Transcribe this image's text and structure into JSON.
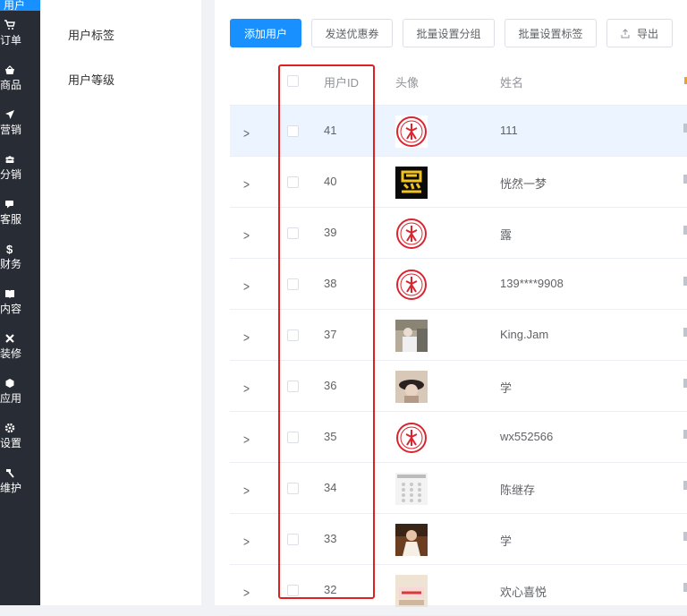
{
  "nav": {
    "active_label": "用户",
    "items": [
      {
        "label": "订单",
        "icon": "cart-icon"
      },
      {
        "label": "商品",
        "icon": "basket-icon"
      },
      {
        "label": "营销",
        "icon": "send-icon"
      },
      {
        "label": "分销",
        "icon": "group-icon"
      },
      {
        "label": "客服",
        "icon": "chat-icon"
      },
      {
        "label": "财务",
        "icon": "dollar-icon"
      },
      {
        "label": "内容",
        "icon": "book-icon"
      },
      {
        "label": "装修",
        "icon": "tools-icon"
      },
      {
        "label": "应用",
        "icon": "cube-icon"
      },
      {
        "label": "设置",
        "icon": "gear-icon"
      },
      {
        "label": "维护",
        "icon": "hammer-icon"
      }
    ]
  },
  "submenu": {
    "items": [
      "用户标签",
      "用户等级"
    ]
  },
  "toolbar": {
    "add_user": "添加用户",
    "send_coupon": "发送优惠券",
    "batch_group": "批量设置分组",
    "batch_tag": "批量设置标签",
    "export": "导出"
  },
  "table": {
    "headers": {
      "uid": "用户ID",
      "avatar": "头像",
      "name": "姓名"
    },
    "rows": [
      {
        "uid": "41",
        "name": "111",
        "avatar": "seal"
      },
      {
        "uid": "40",
        "name": "恍然一梦",
        "avatar": "calligraphy"
      },
      {
        "uid": "39",
        "name": "露",
        "avatar": "seal"
      },
      {
        "uid": "38",
        "name": "139****9908",
        "avatar": "seal"
      },
      {
        "uid": "37",
        "name": "King.Jam",
        "avatar": "photo-person"
      },
      {
        "uid": "36",
        "name": "学",
        "avatar": "photo-hat"
      },
      {
        "uid": "35",
        "name": "wx552566",
        "avatar": "seal"
      },
      {
        "uid": "34",
        "name": "陈继存",
        "avatar": "photo-keypad"
      },
      {
        "uid": "33",
        "name": "学",
        "avatar": "photo-girl"
      },
      {
        "uid": "32",
        "name": "欢心喜悦",
        "avatar": "photo-sign"
      }
    ]
  },
  "colors": {
    "primary": "#1890ff",
    "nav_bg": "#282c34",
    "highlight": "#e02020"
  }
}
